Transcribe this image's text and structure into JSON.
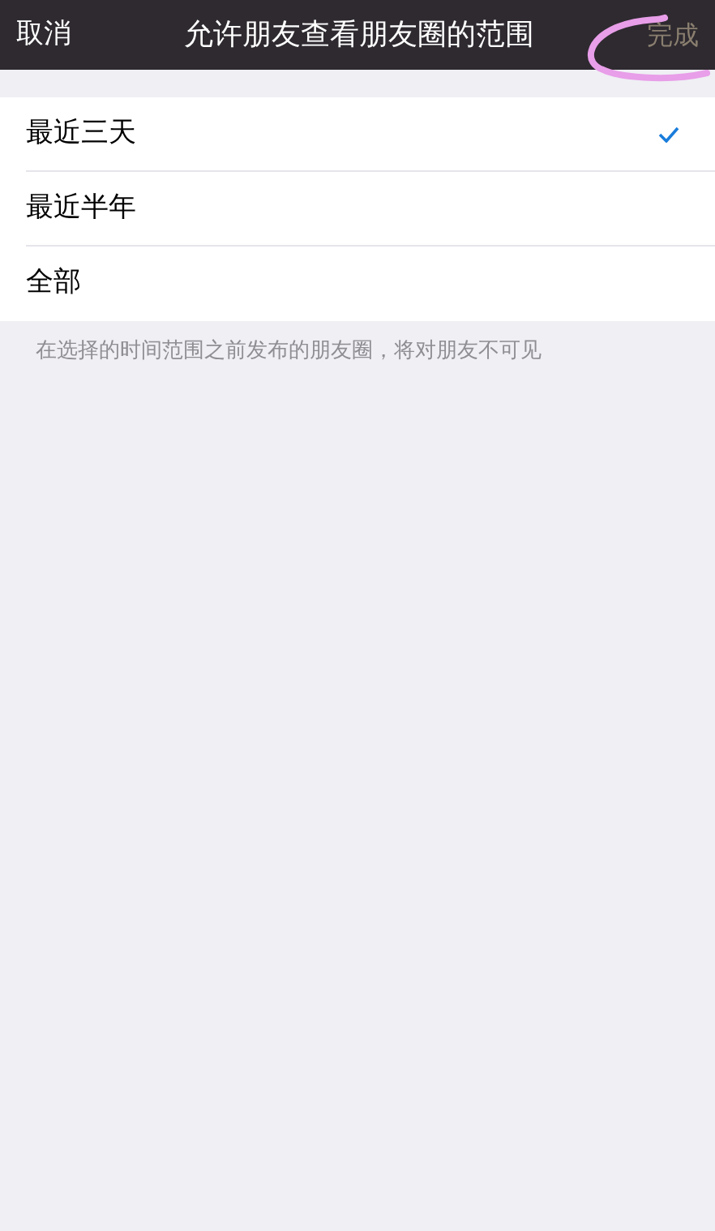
{
  "nav_bar": {
    "cancel": "取消",
    "title": "允许朋友查看朋友圈的范围",
    "done": "完成"
  },
  "options": [
    {
      "label": "最近三天",
      "selected": true
    },
    {
      "label": "最近半年",
      "selected": false
    },
    {
      "label": "全部",
      "selected": false
    }
  ],
  "footer_note": "在选择的时间范围之前发布的朋友圈，将对朋友不可见"
}
